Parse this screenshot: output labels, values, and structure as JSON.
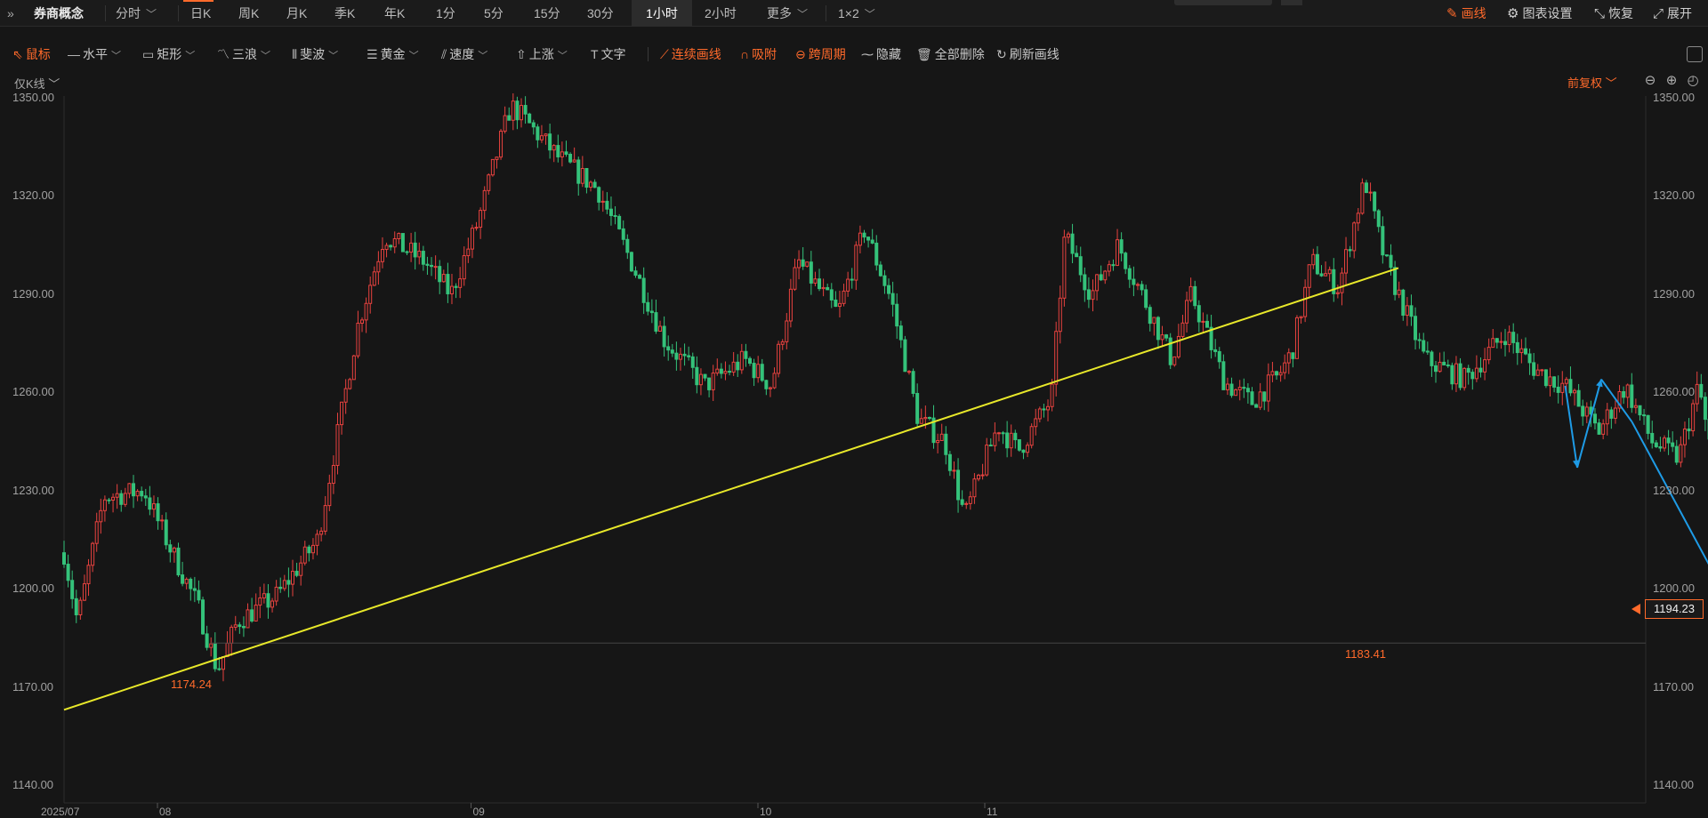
{
  "header": {
    "title": "券商概念",
    "periods": [
      {
        "label": "分时",
        "has_menu": true
      },
      {
        "label": "日K"
      },
      {
        "label": "周K"
      },
      {
        "label": "月K"
      },
      {
        "label": "季K"
      },
      {
        "label": "年K"
      },
      {
        "label": "1分"
      },
      {
        "label": "5分"
      },
      {
        "label": "15分"
      },
      {
        "label": "30分"
      },
      {
        "label": "1小时",
        "active": true
      },
      {
        "label": "2小时"
      },
      {
        "label": "更多",
        "has_menu": true
      },
      {
        "label": "1×2",
        "has_menu": true
      }
    ],
    "right_actions": {
      "draw": "画线",
      "settings": "图表设置",
      "restore": "恢复",
      "expand": "展开"
    }
  },
  "drawing_toolbar": {
    "mouse": "鼠标",
    "horizontal": "水平",
    "rectangle": "矩形",
    "three_wave": "三浪",
    "fibonacci": "斐波",
    "golden": "黄金",
    "speed": "速度",
    "rise": "上涨",
    "text": "文字",
    "continuous": "连续画线",
    "snap": "吸附",
    "cross_period": "跨周期",
    "hide": "隐藏",
    "delete_all": "全部删除",
    "refresh": "刷新画线"
  },
  "chart": {
    "kline_mode": "仅K线",
    "adjust_mode": "前复权",
    "current_price": "1194.23",
    "low_labels": {
      "left": "1174.24",
      "right": "1183.41"
    },
    "colors": {
      "up": "#e8423f",
      "down": "#34c27a",
      "trendline": "#e8e82a",
      "arrows": "#1e9be6",
      "accent": "#ff6a2b",
      "resistance_band": "#3a3d4a"
    }
  },
  "chart_data": {
    "type": "candlestick",
    "ylim": [
      1140,
      1350
    ],
    "y_ticks": [
      "1350.00",
      "1320.00",
      "1290.00",
      "1260.00",
      "1230.00",
      "1200.00",
      "1170.00",
      "1140.00"
    ],
    "x_ticks": [
      "2025/07",
      "08",
      "09",
      "10",
      "11"
    ],
    "trendline": [
      [
        0,
        1163
      ],
      [
        1,
        1298
      ]
    ],
    "current_price": 1194.23,
    "marked_lows": [
      1174.24,
      1183.41
    ],
    "path": [
      [
        0.0,
        1211
      ],
      [
        0.01,
        1190
      ],
      [
        0.03,
        1228
      ],
      [
        0.06,
        1230
      ],
      [
        0.08,
        1212
      ],
      [
        0.1,
        1195
      ],
      [
        0.115,
        1175
      ],
      [
        0.13,
        1190
      ],
      [
        0.16,
        1198
      ],
      [
        0.19,
        1215
      ],
      [
        0.21,
        1258
      ],
      [
        0.22,
        1280
      ],
      [
        0.24,
        1308
      ],
      [
        0.27,
        1300
      ],
      [
        0.29,
        1290
      ],
      [
        0.31,
        1312
      ],
      [
        0.335,
        1348
      ],
      [
        0.37,
        1332
      ],
      [
        0.4,
        1322
      ],
      [
        0.425,
        1300
      ],
      [
        0.45,
        1276
      ],
      [
        0.48,
        1262
      ],
      [
        0.51,
        1270
      ],
      [
        0.53,
        1262
      ],
      [
        0.55,
        1300
      ],
      [
        0.58,
        1284
      ],
      [
        0.6,
        1310
      ],
      [
        0.62,
        1288
      ],
      [
        0.64,
        1252
      ],
      [
        0.66,
        1245
      ],
      [
        0.675,
        1222
      ],
      [
        0.7,
        1250
      ],
      [
        0.715,
        1242
      ],
      [
        0.74,
        1258
      ],
      [
        0.75,
        1308
      ],
      [
        0.77,
        1290
      ],
      [
        0.79,
        1305
      ],
      [
        0.81,
        1288
      ],
      [
        0.83,
        1270
      ],
      [
        0.845,
        1290
      ],
      [
        0.87,
        1263
      ],
      [
        0.89,
        1257
      ],
      [
        0.91,
        1265
      ],
      [
        0.92,
        1272
      ],
      [
        0.935,
        1300
      ],
      [
        0.955,
        1292
      ],
      [
        0.975,
        1325
      ],
      [
        0.99,
        1300
      ],
      [
        1.02,
        1270
      ],
      [
        1.05,
        1264
      ],
      [
        1.08,
        1278
      ],
      [
        1.1,
        1268
      ],
      [
        1.11,
        1265
      ],
      [
        1.125,
        1262
      ],
      [
        1.15,
        1248
      ],
      [
        1.17,
        1262
      ],
      [
        1.19,
        1245
      ],
      [
        1.21,
        1240
      ],
      [
        1.225,
        1262
      ],
      [
        1.235,
        1240
      ],
      [
        1.24,
        1230
      ],
      [
        1.25,
        1198
      ],
      [
        1.26,
        1187
      ],
      [
        1.275,
        1195
      ],
      [
        1.285,
        1194.23
      ]
    ]
  }
}
